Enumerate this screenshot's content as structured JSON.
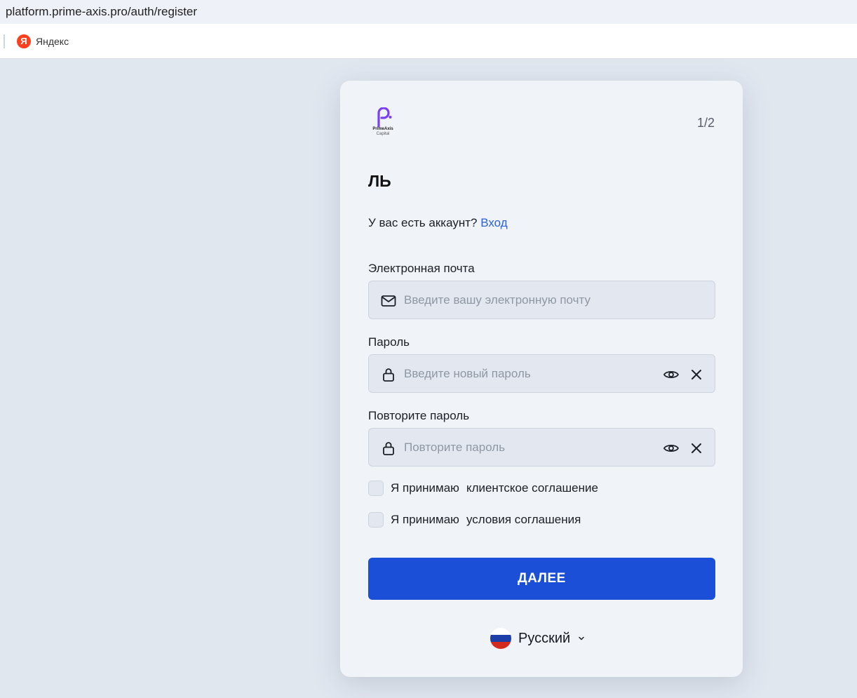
{
  "browser": {
    "url": "platform.prime-axis.pro/auth/register",
    "bookmark_label": "Яндекс",
    "bookmark_icon": "yandex-icon",
    "bookmark_icon_letter": "Я"
  },
  "logo": {
    "brand_line1": "PrimeAxis",
    "brand_line2": "Capital",
    "color": "#7b3ff2"
  },
  "form": {
    "step": "1/2",
    "title": "ЛЬ",
    "have_account_text": "У вас есть аккаунт?",
    "login_link": "Вход",
    "email": {
      "label": "Электронная почта",
      "placeholder": "Введите вашу электронную почту",
      "value": "",
      "icon": "mail-icon"
    },
    "password": {
      "label": "Пароль",
      "placeholder": "Введите новый пароль",
      "value": "",
      "icon": "lock-icon"
    },
    "password_repeat": {
      "label": "Повторите пароль",
      "placeholder": "Повторите пароль",
      "value": "",
      "icon": "lock-icon"
    },
    "agreements": [
      {
        "prefix": "Я принимаю",
        "link": "клиентское соглашение",
        "checked": false
      },
      {
        "prefix": "Я принимаю",
        "link": "условия соглашения",
        "checked": false
      }
    ],
    "next_label": "ДАЛЕЕ"
  },
  "language": {
    "label": "Русский",
    "flag_colors": [
      "#ffffff",
      "#1c3fa8",
      "#d52b1e"
    ]
  },
  "colors": {
    "primary": "#1c4fd8",
    "link": "#2a63d6",
    "page_bg": "#e1e7ef",
    "card_bg": "#f0f3f8"
  }
}
